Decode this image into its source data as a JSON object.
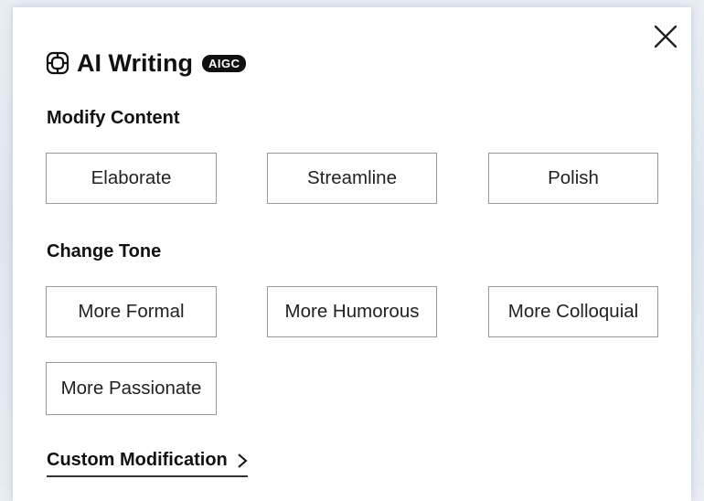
{
  "header": {
    "title": "AI Writing",
    "badge": "AIGC",
    "title_icon": "ai-logo-icon",
    "close_icon": "close-icon"
  },
  "sections": [
    {
      "label": "Modify Content",
      "options": [
        "Elaborate",
        "Streamline",
        "Polish"
      ]
    },
    {
      "label": "Change Tone",
      "options": [
        "More Formal",
        "More Humorous",
        "More Colloquial",
        "More Passionate"
      ]
    }
  ],
  "footer": {
    "custom_label": "Custom Modification",
    "custom_icon": "chevron-right-icon"
  },
  "colors": {
    "background": "#e5ebf1",
    "panel": "#ffffff",
    "text": "#111111",
    "border": "#9a9a9a",
    "badge_bg": "#111111"
  }
}
